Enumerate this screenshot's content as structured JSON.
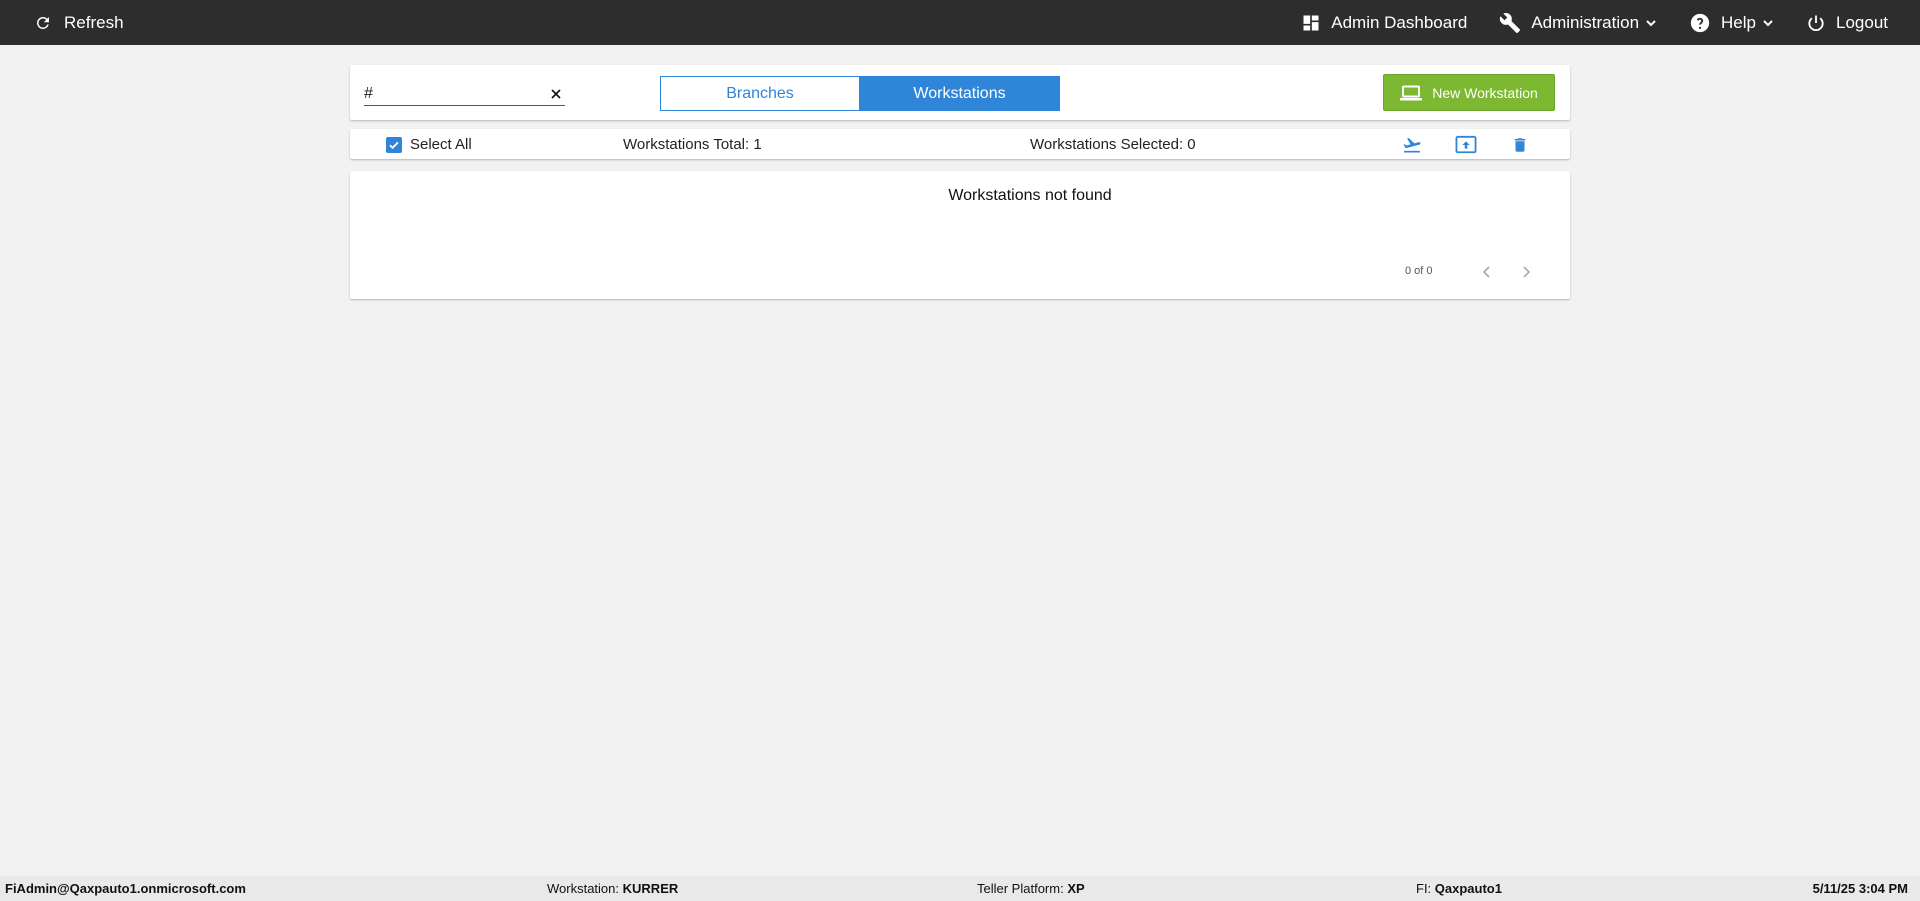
{
  "topbar": {
    "refresh_label": "Refresh",
    "admin_dashboard_label": "Admin Dashboard",
    "administration_label": "Administration",
    "help_label": "Help",
    "logout_label": "Logout"
  },
  "toolbar": {
    "search_value": "#",
    "tabs": [
      {
        "label": "Branches",
        "active": false
      },
      {
        "label": "Workstations",
        "active": true
      }
    ],
    "new_button_label": "New Workstation"
  },
  "select_bar": {
    "select_all_label": "Select All",
    "select_all_checked": true,
    "total_text": "Workstations Total: 1",
    "selected_text": "Workstations Selected: 0"
  },
  "results": {
    "empty_message": "Workstations not found",
    "pager_text": "0 of 0"
  },
  "footer": {
    "user": "FiAdmin@Qaxpauto1.onmicrosoft.com",
    "workstation_label": "Workstation:",
    "workstation_value": "KURRER",
    "platform_label": "Teller Platform:",
    "platform_value": "XP",
    "fi_label": "FI:",
    "fi_value": "Qaxpauto1",
    "datetime": "5/11/25 3:04 PM"
  },
  "colors": {
    "topbar_bg": "#2d2d2d",
    "accent_blue": "#2f86d9",
    "new_button_green": "#7cb832",
    "page_bg": "#f2f2f2"
  }
}
